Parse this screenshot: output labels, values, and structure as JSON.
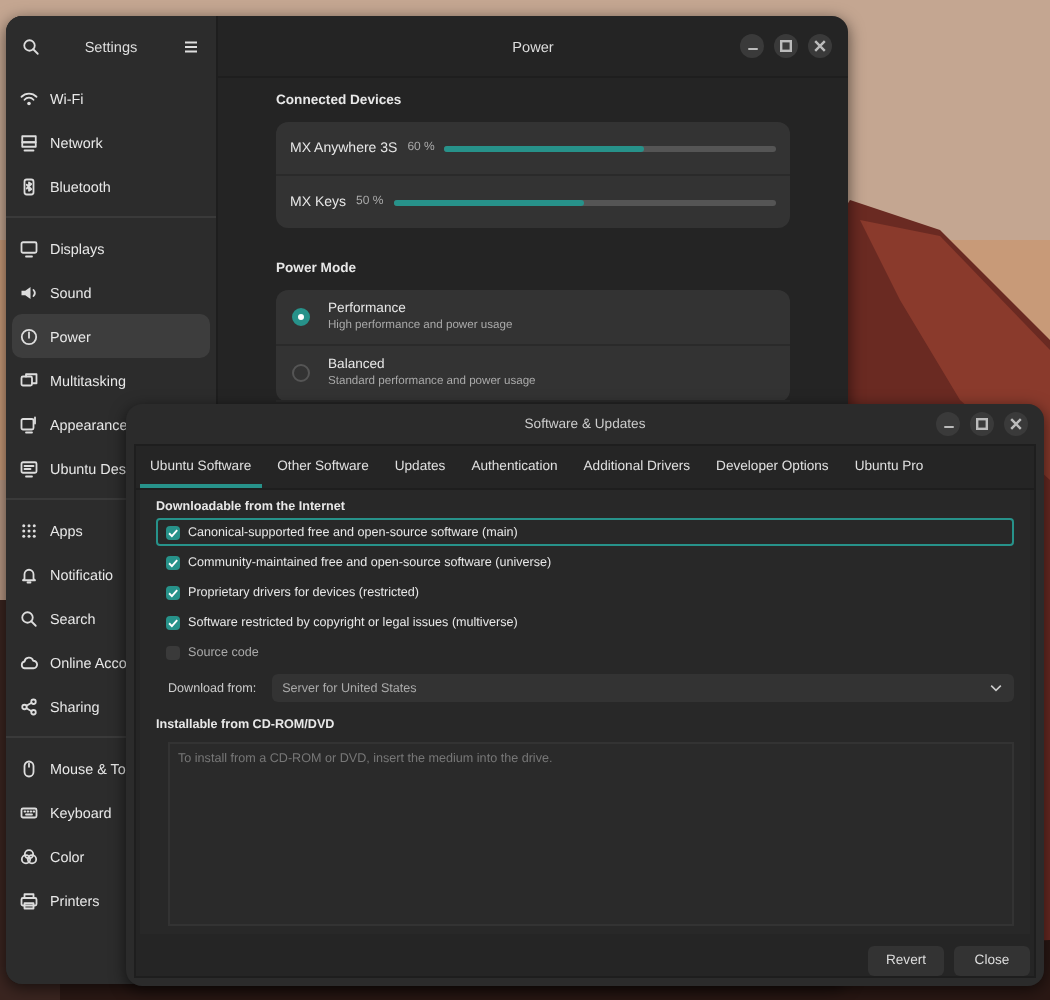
{
  "settings": {
    "title": "Settings",
    "page_title": "Power",
    "sidebar": [
      [
        {
          "label": "Wi-Fi",
          "selected": false
        },
        {
          "label": "Network",
          "selected": false
        },
        {
          "label": "Bluetooth",
          "selected": false
        }
      ],
      [
        {
          "label": "Displays",
          "selected": false
        },
        {
          "label": "Sound",
          "selected": false
        },
        {
          "label": "Power",
          "selected": true
        },
        {
          "label": "Multitasking",
          "selected": false
        },
        {
          "label": "Appearance",
          "selected": false
        },
        {
          "label": "Ubuntu Des",
          "selected": false
        }
      ],
      [
        {
          "label": "Apps",
          "selected": false
        },
        {
          "label": "Notificatio",
          "selected": false
        },
        {
          "label": "Search",
          "selected": false
        },
        {
          "label": "Online Acco",
          "selected": false
        },
        {
          "label": "Sharing",
          "selected": false
        }
      ],
      [
        {
          "label": "Mouse & To",
          "selected": false
        },
        {
          "label": "Keyboard",
          "selected": false
        },
        {
          "label": "Color",
          "selected": false
        },
        {
          "label": "Printers",
          "selected": false
        }
      ]
    ],
    "connected_devices": {
      "heading": "Connected Devices",
      "devices": [
        {
          "name": "MX Anywhere 3S",
          "reading": "60 %",
          "level": 0.6
        },
        {
          "name": "MX Keys",
          "reading": "50 %",
          "level": 0.5
        }
      ]
    },
    "power_mode": {
      "heading": "Power Mode",
      "options": [
        {
          "title": "Performance",
          "subtitle": "High performance and power usage",
          "selected": true
        },
        {
          "title": "Balanced",
          "subtitle": "Standard performance and power usage",
          "selected": false
        }
      ]
    }
  },
  "dialog": {
    "title": "Software & Updates",
    "tabs": [
      {
        "label": "Ubuntu Software",
        "selected": true
      },
      {
        "label": "Other Software",
        "selected": false
      },
      {
        "label": "Updates",
        "selected": false
      },
      {
        "label": "Authentication",
        "selected": false
      },
      {
        "label": "Additional Drivers",
        "selected": false
      },
      {
        "label": "Developer Options",
        "selected": false
      },
      {
        "label": "Ubuntu Pro",
        "selected": false
      }
    ],
    "internet": {
      "heading": "Downloadable from the Internet",
      "sources": [
        {
          "label": "Canonical-supported free and open-source software (main)",
          "checked": true,
          "focused": true
        },
        {
          "label": "Community-maintained free and open-source software (universe)",
          "checked": true,
          "focused": false
        },
        {
          "label": "Proprietary drivers for devices (restricted)",
          "checked": true,
          "focused": false
        },
        {
          "label": "Software restricted by copyright or legal issues (multiverse)",
          "checked": true,
          "focused": false
        },
        {
          "label": "Source code",
          "checked": false,
          "focused": false
        }
      ],
      "download_from": {
        "label": "Download from:",
        "value": "Server for United States"
      }
    },
    "cdrom": {
      "heading": "Installable from CD-ROM/DVD",
      "placeholder": "To install from a CD-ROM or DVD, insert the medium into the drive."
    },
    "buttons": [
      "Revert",
      "Close"
    ]
  }
}
